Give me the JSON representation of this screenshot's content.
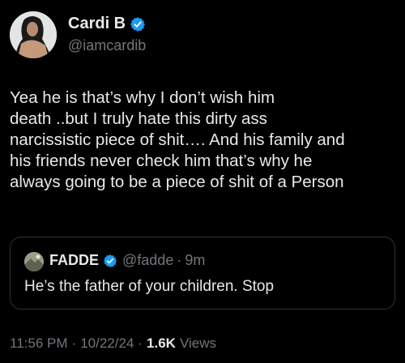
{
  "author": {
    "display_name": "Cardi B",
    "handle": "@iamcardib",
    "verified_icon": "verified-badge-icon"
  },
  "tweet": {
    "lines": [
      "Yea he is that’s why I don’t wish him",
      "death ..but I truly hate this dirty ass",
      "narcissistic piece of shit…. And his family and",
      "his friends never check him that’s why he",
      "always going to be a piece of shit of a Person"
    ]
  },
  "quoted": {
    "display_name": "FADDE",
    "handle": "@fadde",
    "separator": "·",
    "time": "9m",
    "text": "He’s the father of your children. Stop"
  },
  "meta": {
    "time": "11:56 PM",
    "separator": "·",
    "date": "10/22/24",
    "views_count": "1.6K",
    "views_label": "Views"
  },
  "colors": {
    "background": "#000000",
    "text": "#e7e9ea",
    "secondary": "#71767b",
    "verified": "#1d9bf0",
    "border": "#2f3336"
  }
}
